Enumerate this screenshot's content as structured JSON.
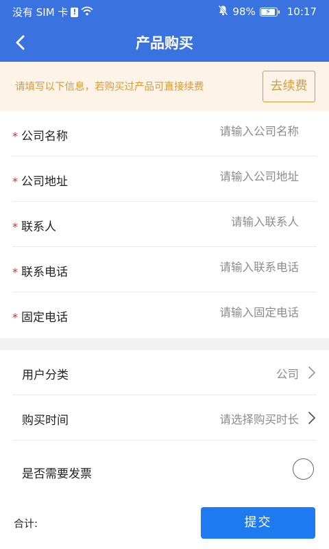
{
  "status_bar": {
    "carrier": "没有 SIM 卡",
    "sim_alert": "!",
    "battery": "98%",
    "battery_level": 0.98,
    "time": "10:17",
    "icons": [
      "sim-alert-icon",
      "wifi-icon",
      "mute-bell-icon",
      "battery-charging-icon"
    ]
  },
  "navbar": {
    "back_icon": "chevron-left-icon",
    "title": "产品购买"
  },
  "notice": {
    "text": "请填写以下信息，若购买过产品可直接续费",
    "renew_label": "去续费"
  },
  "form": {
    "required_mark": "*",
    "fields": [
      {
        "label": "公司名称",
        "placeholder": "请输入公司名称",
        "value": ""
      },
      {
        "label": "公司地址",
        "placeholder": "请输入公司地址",
        "value": ""
      },
      {
        "label": "联系人",
        "placeholder": "请输入联系人",
        "value": ""
      },
      {
        "label": "联系电话",
        "placeholder": "请输入联系电话",
        "value": ""
      },
      {
        "label": "固定电话",
        "placeholder": "请输入固定电话",
        "value": ""
      }
    ]
  },
  "options": {
    "user_category": {
      "label": "用户分类",
      "value": "公司",
      "icon": "chevron-right-icon"
    },
    "purchase_time": {
      "label": "购买时间",
      "value": "请选择购买时长",
      "icon": "chevron-right-icon"
    },
    "invoice": {
      "label": "是否需要发票",
      "checked": false,
      "icon": "radio-icon"
    }
  },
  "footer": {
    "total_label": "合计:",
    "submit_label": "提交"
  },
  "colors": {
    "header_bg": "#3a72e0",
    "notice_bg": "#fdf3e7",
    "notice_accent": "#d99a3c",
    "required": "#d62e2e",
    "submit_bg": "#1e7af0",
    "page_bg": "#f2f2f2"
  }
}
